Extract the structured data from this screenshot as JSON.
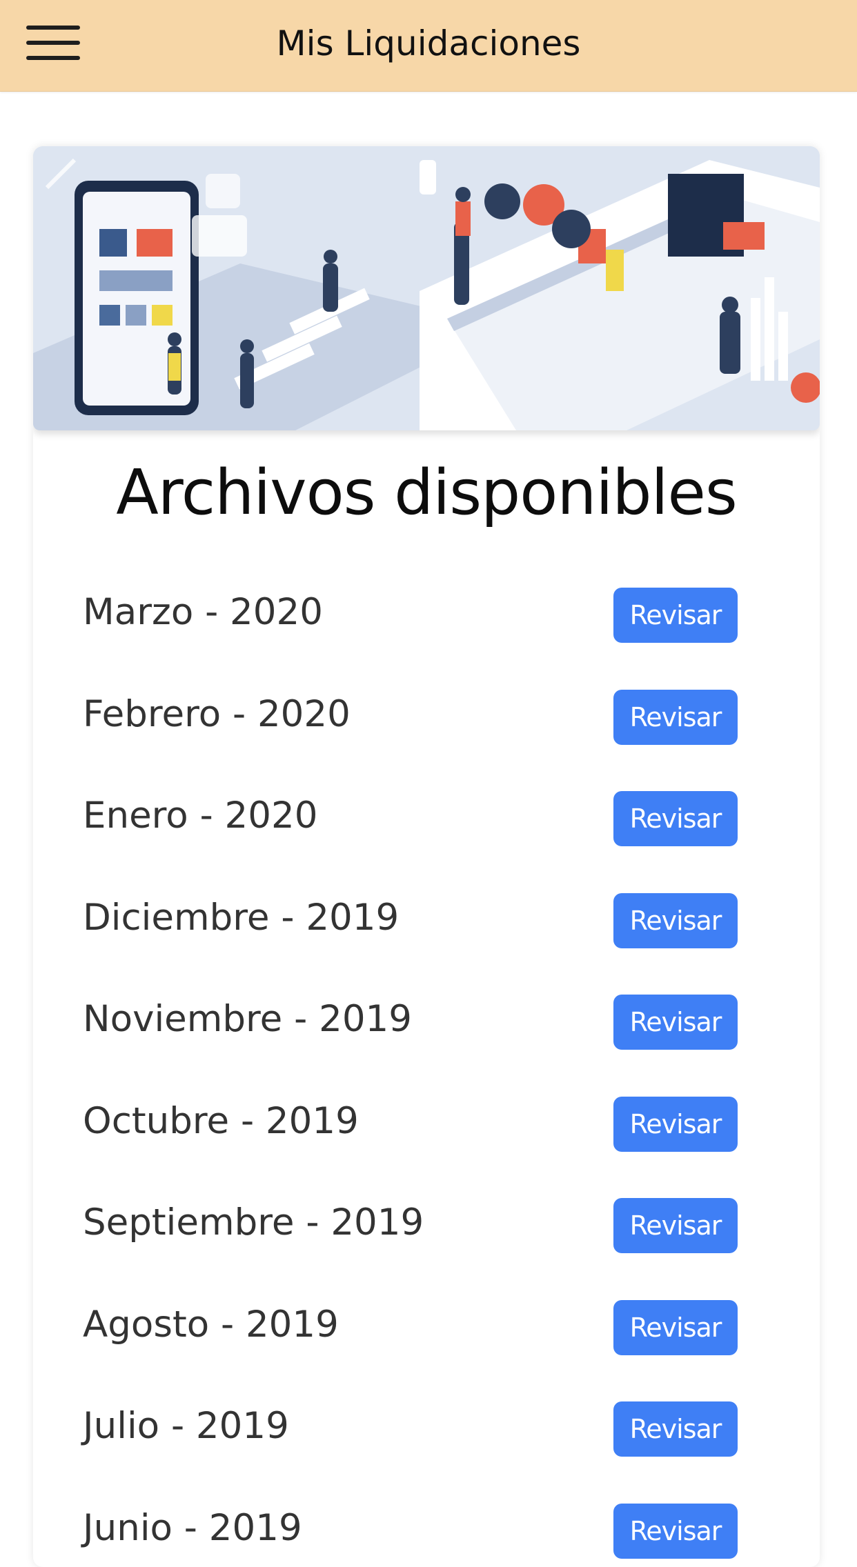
{
  "appbar": {
    "title": "Mis Liquidaciones",
    "menu_icon": "hamburger-menu-icon"
  },
  "card": {
    "banner": "office-teamwork-illustration",
    "title": "Archivos disponibles",
    "button_color": "#3f7ff5",
    "items": [
      {
        "label": "Marzo - 2020",
        "button": "Revisar"
      },
      {
        "label": "Febrero - 2020",
        "button": "Revisar"
      },
      {
        "label": "Enero - 2020",
        "button": "Revisar"
      },
      {
        "label": "Diciembre - 2019",
        "button": "Revisar"
      },
      {
        "label": "Noviembre - 2019",
        "button": "Revisar"
      },
      {
        "label": "Octubre - 2019",
        "button": "Revisar"
      },
      {
        "label": "Septiembre - 2019",
        "button": "Revisar"
      },
      {
        "label": "Agosto - 2019",
        "button": "Revisar"
      },
      {
        "label": "Julio - 2019",
        "button": "Revisar"
      },
      {
        "label": "Junio - 2019",
        "button": "Revisar"
      }
    ]
  }
}
